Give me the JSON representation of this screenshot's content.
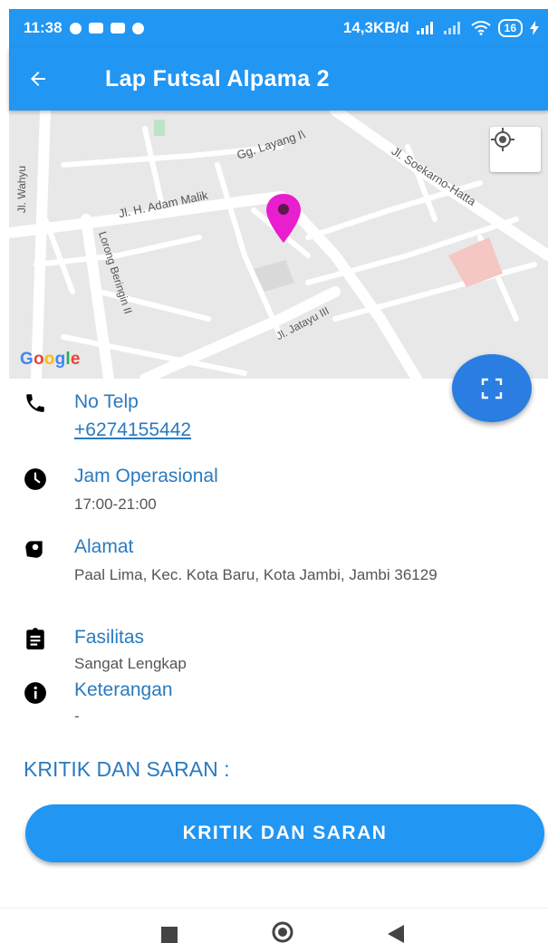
{
  "status_bar": {
    "time": "11:38",
    "network_speed": "14,3KB/d",
    "battery": "16"
  },
  "app_bar": {
    "title": "Lap Futsal Alpama 2",
    "back_icon": "arrow-left-icon"
  },
  "map": {
    "streets": [
      "Gg. Layang I\\",
      "Jl. Soekarno-Hatta",
      "Jl. Wahyu",
      "Jl. H. Adam Malik",
      "Lorong Beringin II",
      "Jl. Jatayu III"
    ],
    "marker_color": "#e91ecf",
    "attribution": "Google",
    "locate_icon": "my-location-icon",
    "expand_icon": "fullscreen-icon"
  },
  "details": {
    "phone": {
      "label": "No Telp",
      "value": "+6274155442",
      "icon": "phone-icon"
    },
    "hours": {
      "label": "Jam Operasional",
      "value": "17:00-21:00",
      "icon": "clock-icon"
    },
    "address": {
      "label": "Alamat",
      "value": "Paal Lima, Kec. Kota Baru, Kota Jambi, Jambi 36129",
      "icon": "location-icon"
    },
    "facilities": {
      "label": "Fasilitas",
      "value": "Sangat Lengkap",
      "icon": "clipboard-icon"
    },
    "notes": {
      "label": "Keterangan",
      "value": "-",
      "icon": "info-icon"
    }
  },
  "feedback": {
    "section_title": "KRITIK DAN SARAN :",
    "button_label": "KRITIK DAN SARAN"
  },
  "colors": {
    "primary": "#2196f3",
    "label_blue": "#2a7abf",
    "fab": "#2a7de1"
  }
}
